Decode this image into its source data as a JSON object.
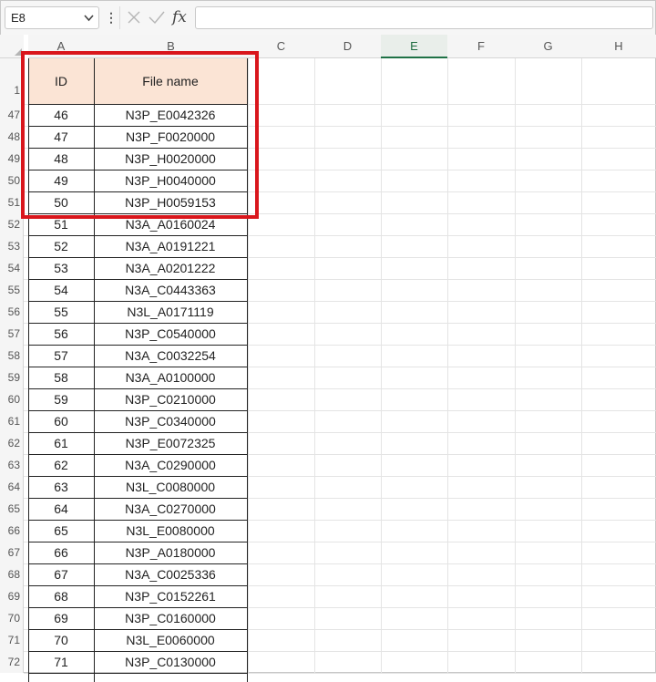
{
  "formula_bar": {
    "name_box": "E8",
    "more_icon": "⋮",
    "cancel_icon": "×",
    "enter_icon": "✓",
    "fx_label": "fx",
    "formula": ""
  },
  "columns": [
    "A",
    "B",
    "C",
    "D",
    "E",
    "F",
    "G",
    "H"
  ],
  "selected_column": "E",
  "table_headers": {
    "id": "ID",
    "file_name": "File name"
  },
  "header_row_number": "1",
  "rows": [
    {
      "row": "47",
      "id": "46",
      "file": "N3P_E0042326"
    },
    {
      "row": "48",
      "id": "47",
      "file": "N3P_F0020000"
    },
    {
      "row": "49",
      "id": "48",
      "file": "N3P_H0020000"
    },
    {
      "row": "50",
      "id": "49",
      "file": "N3P_H0040000"
    },
    {
      "row": "51",
      "id": "50",
      "file": "N3P_H0059153"
    },
    {
      "row": "52",
      "id": "51",
      "file": "N3A_A0160024"
    },
    {
      "row": "53",
      "id": "52",
      "file": "N3A_A0191221"
    },
    {
      "row": "54",
      "id": "53",
      "file": "N3A_A0201222"
    },
    {
      "row": "55",
      "id": "54",
      "file": "N3A_C0443363"
    },
    {
      "row": "56",
      "id": "55",
      "file": "N3L_A0171119"
    },
    {
      "row": "57",
      "id": "56",
      "file": "N3P_C0540000"
    },
    {
      "row": "58",
      "id": "57",
      "file": "N3A_C0032254"
    },
    {
      "row": "59",
      "id": "58",
      "file": "N3A_A0100000"
    },
    {
      "row": "60",
      "id": "59",
      "file": "N3P_C0210000"
    },
    {
      "row": "61",
      "id": "60",
      "file": "N3P_C0340000"
    },
    {
      "row": "62",
      "id": "61",
      "file": "N3P_E0072325"
    },
    {
      "row": "63",
      "id": "62",
      "file": "N3A_C0290000"
    },
    {
      "row": "64",
      "id": "63",
      "file": "N3L_C0080000"
    },
    {
      "row": "65",
      "id": "64",
      "file": "N3A_C0270000"
    },
    {
      "row": "66",
      "id": "65",
      "file": "N3L_E0080000"
    },
    {
      "row": "67",
      "id": "66",
      "file": "N3P_A0180000"
    },
    {
      "row": "68",
      "id": "67",
      "file": "N3A_C0025336"
    },
    {
      "row": "69",
      "id": "68",
      "file": "N3P_C0152261"
    },
    {
      "row": "70",
      "id": "69",
      "file": "N3P_C0160000"
    },
    {
      "row": "71",
      "id": "70",
      "file": "N3L_E0060000"
    },
    {
      "row": "72",
      "id": "71",
      "file": "N3P_C0130000"
    }
  ],
  "colors": {
    "header_fill": "#fbe4d5",
    "highlight_border": "#d9161c",
    "selected_column_accent": "#1e7145"
  }
}
